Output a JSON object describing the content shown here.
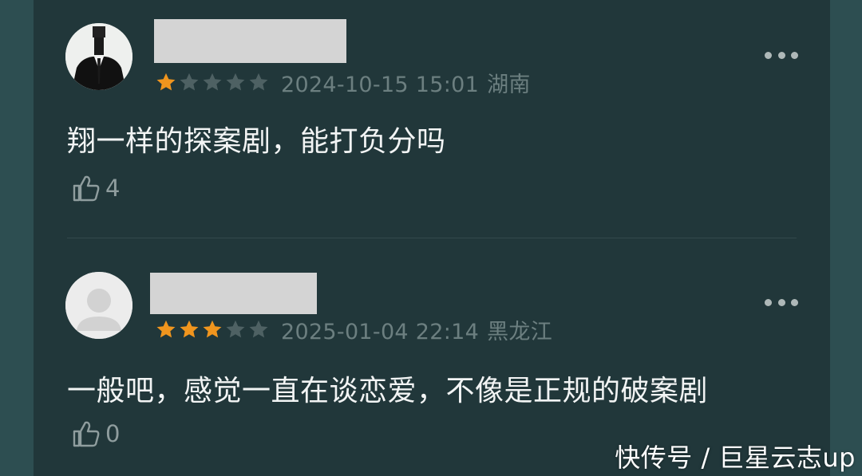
{
  "comments": [
    {
      "rating": 1,
      "rating_max": 5,
      "datetime": "2024-10-15 15:01",
      "location": "湖南",
      "text": "翔一样的探案剧，能打负分吗",
      "likes": "4",
      "avatar": "suit-photo"
    },
    {
      "rating": 3,
      "rating_max": 5,
      "datetime": "2025-01-04 22:14",
      "location": "黑龙江",
      "text": "一般吧，感觉一直在谈恋爱，不像是正规的破案剧",
      "likes": "0",
      "avatar": "default-user"
    }
  ],
  "icons": {
    "more": "more-dots-icon",
    "like": "thumbs-up-icon",
    "star": "star-icon"
  },
  "colors": {
    "star_filled": "#f0951e",
    "star_empty": "#4e6163",
    "panel_bg": "#21373a",
    "side_bg": "#2d4e51",
    "meta_text": "#6c7f80"
  },
  "watermark": "快传号 / 巨星云志up"
}
